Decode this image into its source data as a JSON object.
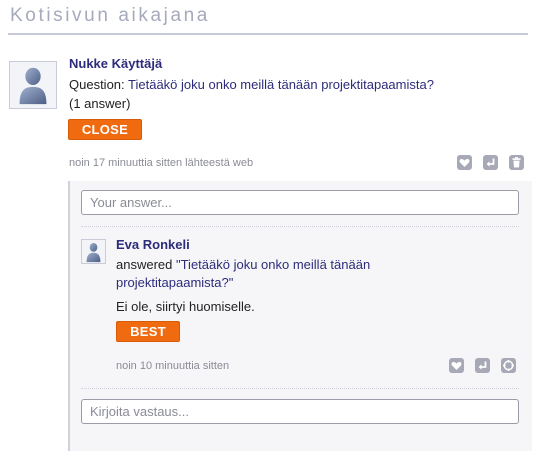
{
  "page": {
    "title": "Kotisivun aikajana"
  },
  "post": {
    "author": "Nukke Käyttäjä",
    "question_prefix": "Question: ",
    "question_text": "Tietääkö joku onko meillä tänään projektitapaamista?",
    "answer_count": "(1 answer)",
    "close_label": "CLOSE",
    "meta": "noin 17 minuuttia sitten lähteestä web",
    "answer_placeholder": "Your answer..."
  },
  "answer": {
    "author": "Eva Ronkeli",
    "answered_prefix": "answered ",
    "answered_quote": "\"Tietääkö joku onko meillä tänään projektitapaamista?\"",
    "text": "Ei ole, siirtyi huomiselle.",
    "best_label": "BEST",
    "meta": "noin 10 minuuttia sitten"
  },
  "reply": {
    "placeholder": "Kirjoita vastaus..."
  },
  "icons": {
    "post": [
      "heart-icon",
      "reply-icon",
      "trash-icon"
    ],
    "answer": [
      "heart-icon",
      "reply-icon",
      "share-icon"
    ]
  },
  "colors": {
    "accent_orange": "#f06a10",
    "link_navy": "#2d2c7b",
    "meta_gray": "#8a8b96",
    "title_gray": "#a7a9bc"
  }
}
